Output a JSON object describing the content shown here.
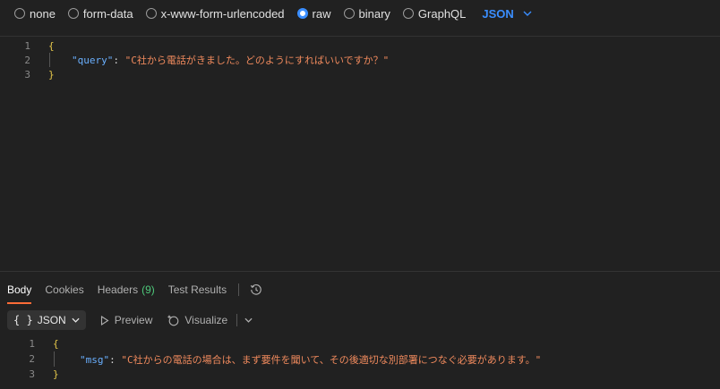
{
  "body_type": {
    "options": [
      {
        "label": "none",
        "checked": false
      },
      {
        "label": "form-data",
        "checked": false
      },
      {
        "label": "x-www-form-urlencoded",
        "checked": false
      },
      {
        "label": "raw",
        "checked": true
      },
      {
        "label": "binary",
        "checked": false
      },
      {
        "label": "GraphQL",
        "checked": false
      }
    ],
    "language": "JSON"
  },
  "request_editor": {
    "line_numbers": [
      "1",
      "2",
      "3"
    ],
    "open_brace": "{",
    "key": "\"query\"",
    "colon": ": ",
    "value": "\"C社から電話がきました。どのようにすればいいですか？\"",
    "close_brace": "}"
  },
  "response": {
    "tabs": {
      "body": "Body",
      "cookies": "Cookies",
      "headers": "Headers",
      "headers_count": "(9)",
      "test_results": "Test Results"
    },
    "toolbar": {
      "format_icon": "{ }",
      "format_label": "JSON",
      "preview": "Preview",
      "visualize": "Visualize"
    },
    "editor": {
      "line_numbers": [
        "1",
        "2",
        "3"
      ],
      "open_brace": "{",
      "key": "\"msg\"",
      "colon": ": ",
      "value": "\"C社からの電話の場合は、まず要件を聞いて、その後適切な別部署につなぐ必要があります。\"",
      "close_brace": "}"
    }
  },
  "colors": {
    "accent_blue": "#3a8eff",
    "active_tab_underline": "#ff6c37",
    "badge_green": "#4ec97b",
    "json_key": "#6ab0ff",
    "json_string": "#f08a5d",
    "json_brace": "#e6c84a"
  },
  "icons": {
    "language_dropdown": "chevron-down-icon",
    "history": "history-clock-icon",
    "preview": "play-triangle-icon",
    "visualize": "visualize-sparkle-icon",
    "format_dropdown": "chevron-down-icon"
  }
}
